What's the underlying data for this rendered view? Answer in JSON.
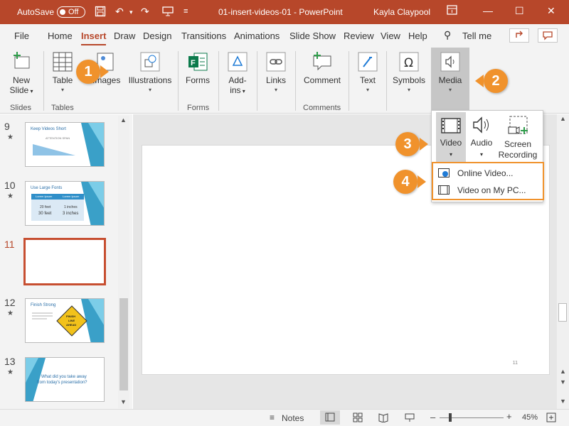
{
  "titlebar": {
    "autosave_label": "AutoSave",
    "autosave_state": "Off",
    "doc_title": "01-insert-videos-01 - PowerPoint",
    "user": "Kayla Claypool"
  },
  "menu": {
    "tabs": [
      "File",
      "Home",
      "Insert",
      "Draw",
      "Design",
      "Transitions",
      "Animations",
      "Slide Show",
      "Review",
      "View",
      "Help"
    ],
    "active_tab": "Insert",
    "tell_me": "Tell me"
  },
  "ribbon": {
    "new_slide": [
      "New",
      "Slide"
    ],
    "table": "Table",
    "images": "Images",
    "illustrations": "Illustrations",
    "forms": "Forms",
    "addins": [
      "Add-",
      "ins"
    ],
    "links": "Links",
    "comment": "Comment",
    "text": "Text",
    "symbols": "Symbols",
    "media": "Media",
    "groups": {
      "slides": "Slides",
      "tables": "Tables",
      "forms": "Forms",
      "comments": "Comments"
    }
  },
  "slides_panel": {
    "thumbs": [
      {
        "num": "9",
        "title": "Keep Videos Short",
        "caption": "ATTENTION SPAN"
      },
      {
        "num": "10",
        "title": "Use Large Fonts",
        "cells": [
          "Lorem Ipsum",
          "Lorem Ipsum",
          "20 feet",
          "1 inches",
          "30 feet",
          "3 inches"
        ]
      },
      {
        "num": "11"
      },
      {
        "num": "12",
        "title": "Finish Strong",
        "sign": [
          "FINISH",
          "LINE",
          "AHEAD"
        ]
      },
      {
        "num": "13",
        "text": [
          "What did you take away",
          "from today's presentation?"
        ]
      }
    ],
    "current": "11"
  },
  "slide": {
    "page_number": "11"
  },
  "media_dropdown": {
    "video": "Video",
    "audio": "Audio",
    "screen_recording": [
      "Screen",
      "Recording"
    ],
    "online_video": "Online Video...",
    "video_on_pc": "Video on My PC..."
  },
  "callouts": [
    "1",
    "2",
    "3",
    "4"
  ],
  "status": {
    "notes": "Notes",
    "zoom": "45%"
  },
  "colors": {
    "accent": "#b7472a",
    "callout": "#f0922c"
  }
}
